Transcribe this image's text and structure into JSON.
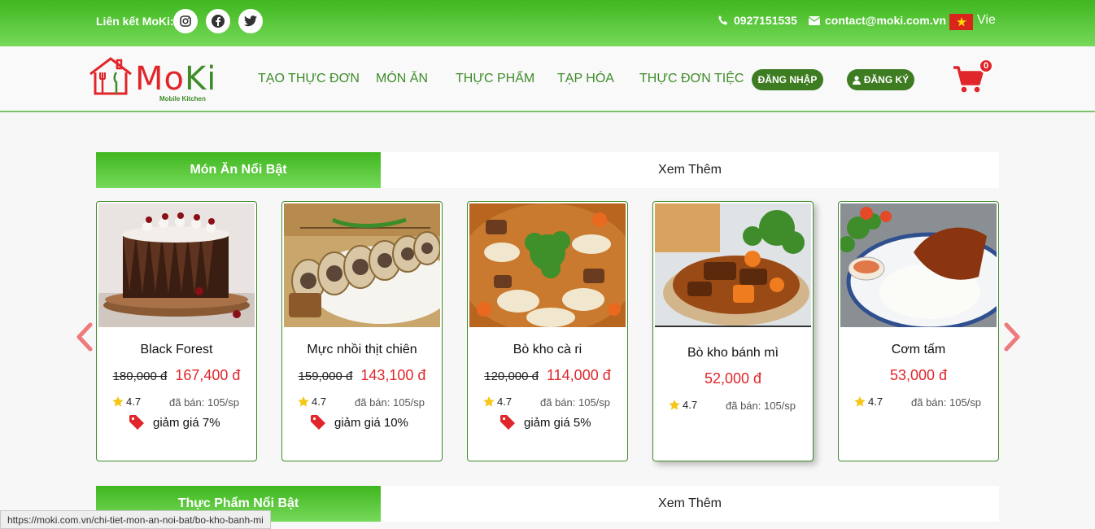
{
  "topbar": {
    "links_label": "Liên kết MoKi:",
    "social_icons": [
      "instagram-icon",
      "facebook-icon",
      "twitter-icon"
    ],
    "phone": "0927151535",
    "email": "contact@moki.com.vn",
    "language": "Vie"
  },
  "brand": {
    "logo_text_a": "Mo",
    "logo_text_b": "Ki",
    "logo_sub": "Mobile Kitchen"
  },
  "nav": {
    "items": [
      "TẠO THỰC ĐƠN",
      "MÓN ĂN",
      "THỰC PHẨM",
      "TẠP HÓA",
      "THỰC ĐƠN TIỆC"
    ],
    "login": "ĐĂNG NHẬP",
    "register": "ĐĂNG KÝ",
    "cart_count": "0"
  },
  "sections": [
    {
      "title": "Món Ăn Nổi Bật",
      "more": "Xem Thêm"
    },
    {
      "title": "Thực Phẩm Nổi Bật",
      "more": "Xem Thêm"
    }
  ],
  "products": [
    {
      "name": "Black Forest",
      "old_price": "180,000 đ",
      "price": "167,400 đ",
      "rating": "4.7",
      "sold": "đã bán: 105/sp",
      "discount": "giảm giá 7%"
    },
    {
      "name": "Mực nhồi thịt chiên",
      "old_price": "159,000 đ",
      "price": "143,100 đ",
      "rating": "4.7",
      "sold": "đã bán: 105/sp",
      "discount": "giảm giá 10%"
    },
    {
      "name": "Bò kho cà ri",
      "old_price": "120,000 đ",
      "price": "114,000 đ",
      "rating": "4.7",
      "sold": "đã bán: 105/sp",
      "discount": "giảm giá 5%"
    },
    {
      "name": "Bò kho bánh mì",
      "old_price": "",
      "price": "52,000 đ",
      "rating": "4.7",
      "sold": "đã bán: 105/sp",
      "discount": ""
    },
    {
      "name": "Cơm tấm",
      "old_price": "",
      "price": "53,000 đ",
      "rating": "4.7",
      "sold": "đã bán: 105/sp",
      "discount": ""
    }
  ],
  "status_url": "https://moki.com.vn/chi-tiet-mon-an-noi-bat/bo-kho-banh-mi",
  "colors": {
    "green": "#3e8c2a",
    "red": "#e0262b",
    "topbar_green": "#4cc22b"
  }
}
